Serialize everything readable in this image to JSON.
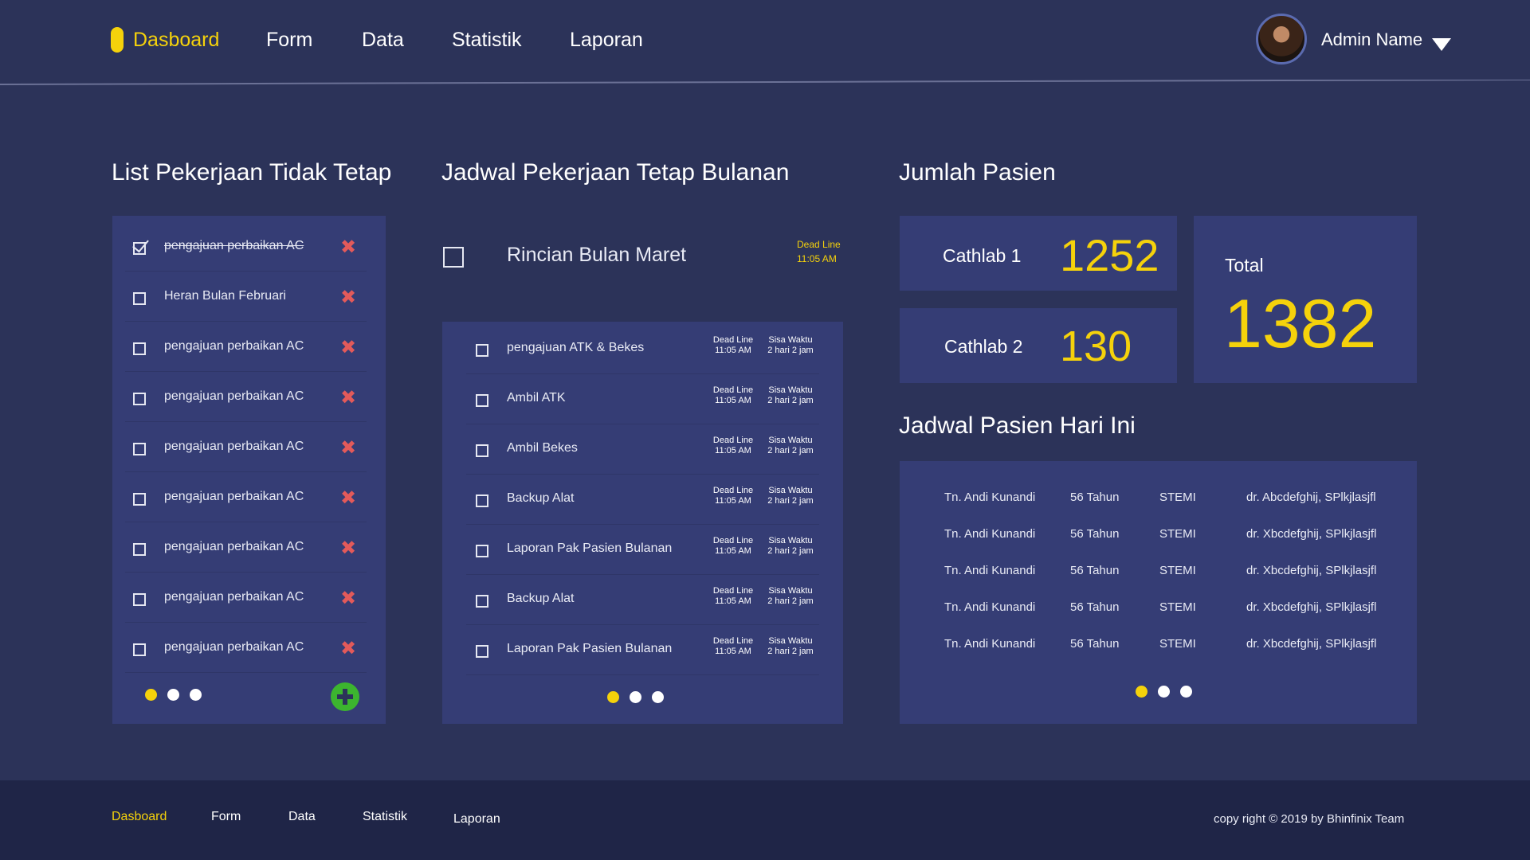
{
  "colors": {
    "background": "#2c3359",
    "card": "#353d75",
    "accent": "#f5d20b",
    "delete": "#e35a5a",
    "add": "#3cb52f",
    "footer": "#1f2547"
  },
  "nav": {
    "items": [
      "Dasboard",
      "Form",
      "Data",
      "Statistik",
      "Laporan"
    ],
    "active": "Dasboard"
  },
  "user": {
    "name": "Admin Name",
    "avatar_icon": "user-photo"
  },
  "todo": {
    "title": "List Pekerjaan Tidak Tetap",
    "items": [
      {
        "text": "pengajuan perbaikan AC",
        "checked": true
      },
      {
        "text": "Heran Bulan Februari",
        "checked": false
      },
      {
        "text": "pengajuan perbaikan AC",
        "checked": false
      },
      {
        "text": "pengajuan perbaikan AC",
        "checked": false
      },
      {
        "text": "pengajuan perbaikan AC",
        "checked": false
      },
      {
        "text": "pengajuan perbaikan AC",
        "checked": false
      },
      {
        "text": "pengajuan perbaikan AC",
        "checked": false
      },
      {
        "text": "pengajuan perbaikan AC",
        "checked": false
      },
      {
        "text": "pengajuan perbaikan AC",
        "checked": false
      }
    ],
    "delete_glyph": "✖"
  },
  "schedule": {
    "title": "Jadwal Pekerjaan Tetap Bulanan",
    "month_title": "Rincian Bulan Maret",
    "month_deadline_label": "Dead Line",
    "month_deadline_time": "11:05 AM",
    "items": [
      {
        "text": "pengajuan ATK & Bekes",
        "deadline_label": "Dead Line",
        "deadline_time": "11:05 AM",
        "sisa_label": "Sisa Waktu",
        "sisa_value": "2 hari 2 jam"
      },
      {
        "text": "Ambil ATK",
        "deadline_label": "Dead Line",
        "deadline_time": "11:05 AM",
        "sisa_label": "Sisa Waktu",
        "sisa_value": "2 hari 2 jam"
      },
      {
        "text": "Ambil Bekes",
        "deadline_label": "Dead Line",
        "deadline_time": "11:05 AM",
        "sisa_label": "Sisa Waktu",
        "sisa_value": "2 hari 2 jam"
      },
      {
        "text": "Backup Alat",
        "deadline_label": "Dead Line",
        "deadline_time": "11:05 AM",
        "sisa_label": "Sisa Waktu",
        "sisa_value": "2 hari 2 jam"
      },
      {
        "text": "Laporan Pak Pasien Bulanan",
        "deadline_label": "Dead Line",
        "deadline_time": "11:05 AM",
        "sisa_label": "Sisa Waktu",
        "sisa_value": "2 hari 2 jam"
      },
      {
        "text": "Backup Alat",
        "deadline_label": "Dead Line",
        "deadline_time": "11:05 AM",
        "sisa_label": "Sisa Waktu",
        "sisa_value": "2 hari 2 jam"
      },
      {
        "text": "Laporan Pak Pasien Bulanan",
        "deadline_label": "Dead Line",
        "deadline_time": "11:05 AM",
        "sisa_label": "Sisa Waktu",
        "sisa_value": "2 hari 2 jam"
      }
    ]
  },
  "patients": {
    "title": "Jumlah Pasien",
    "cathlab1_label": "Cathlab 1",
    "cathlab1_value": "1252",
    "cathlab2_label": "Cathlab 2",
    "cathlab2_value": "130",
    "total_label": "Total",
    "total_value": "1382"
  },
  "today": {
    "title": "Jadwal Pasien Hari Ini",
    "rows": [
      {
        "name": "Tn. Andi Kunandi",
        "age": "56 Tahun",
        "diagnosis": "STEMI",
        "doctor": "dr. Abcdefghij, SPlkjlasjfl"
      },
      {
        "name": "Tn. Andi Kunandi",
        "age": "56 Tahun",
        "diagnosis": "STEMI",
        "doctor": "dr. Xbcdefghij, SPlkjlasjfl"
      },
      {
        "name": "Tn. Andi Kunandi",
        "age": "56 Tahun",
        "diagnosis": "STEMI",
        "doctor": "dr. Xbcdefghij, SPlkjlasjfl"
      },
      {
        "name": "Tn. Andi Kunandi",
        "age": "56 Tahun",
        "diagnosis": "STEMI",
        "doctor": "dr. Xbcdefghij, SPlkjlasjfl"
      },
      {
        "name": "Tn. Andi Kunandi",
        "age": "56 Tahun",
        "diagnosis": "STEMI",
        "doctor": "dr. Xbcdefghij, SPlkjlasjfl"
      }
    ]
  },
  "pagination": {
    "pages": 3,
    "active_index": 0
  },
  "footer": {
    "items": [
      "Dasboard",
      "Form",
      "Data",
      "Statistik",
      "Laporan"
    ],
    "copyright": "copy right © 2019 by Bhinfinix Team"
  }
}
